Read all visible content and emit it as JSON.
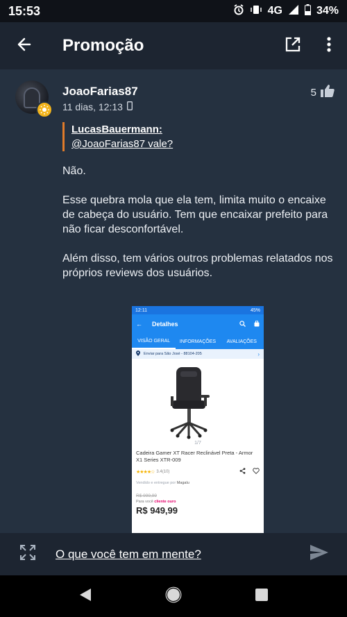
{
  "status_bar": {
    "time": "15:53",
    "network": "4G",
    "battery": "34%"
  },
  "app_bar": {
    "title": "Promoção"
  },
  "post": {
    "author": "JoaoFarias87",
    "timestamp": "11 dias, 12:13",
    "likes": "5",
    "quote": {
      "author": "LucasBauermann:",
      "text": "@JoaoFarias87  vale?"
    },
    "paragraphs": [
      "Não.",
      "Esse quebra mola que ela tem, limita muito o encaixe de cabeça do usuário. Tem que encaixar prefeito para não ficar desconfortável.",
      "Além disso, tem vários outros problemas relatados nos próprios reviews dos usuários."
    ]
  },
  "embedded_screenshot": {
    "status_time": "12:11",
    "status_right": "45%",
    "header_title": "Detalhes",
    "tabs": [
      "VISÃO GERAL",
      "INFORMAÇÕES",
      "AVALIAÇÕES"
    ],
    "shipping": "Enviar para São José - 88104-205",
    "page_indicator": "1/7",
    "product_name": "Cadeira Gamer XT Racer Reclinável Preta - Armor X1 Series XTR-009",
    "rating_stars": "★★★★☆",
    "rating_value": "3.4(10)",
    "seller_prefix": "Vendido e entregue por",
    "seller": "Magalu",
    "old_price": "R$ 999,99",
    "para_voce": "Para você",
    "badge": "cliente ouro",
    "price": "R$ 949,99"
  },
  "composer": {
    "placeholder": "O que você tem em mente?"
  },
  "colors": {
    "background": "#253140",
    "app_bar": "#1d2531",
    "quote_accent": "#e07b2a",
    "badge": "#f2b41c",
    "magalu_blue": "#1e88f0"
  }
}
